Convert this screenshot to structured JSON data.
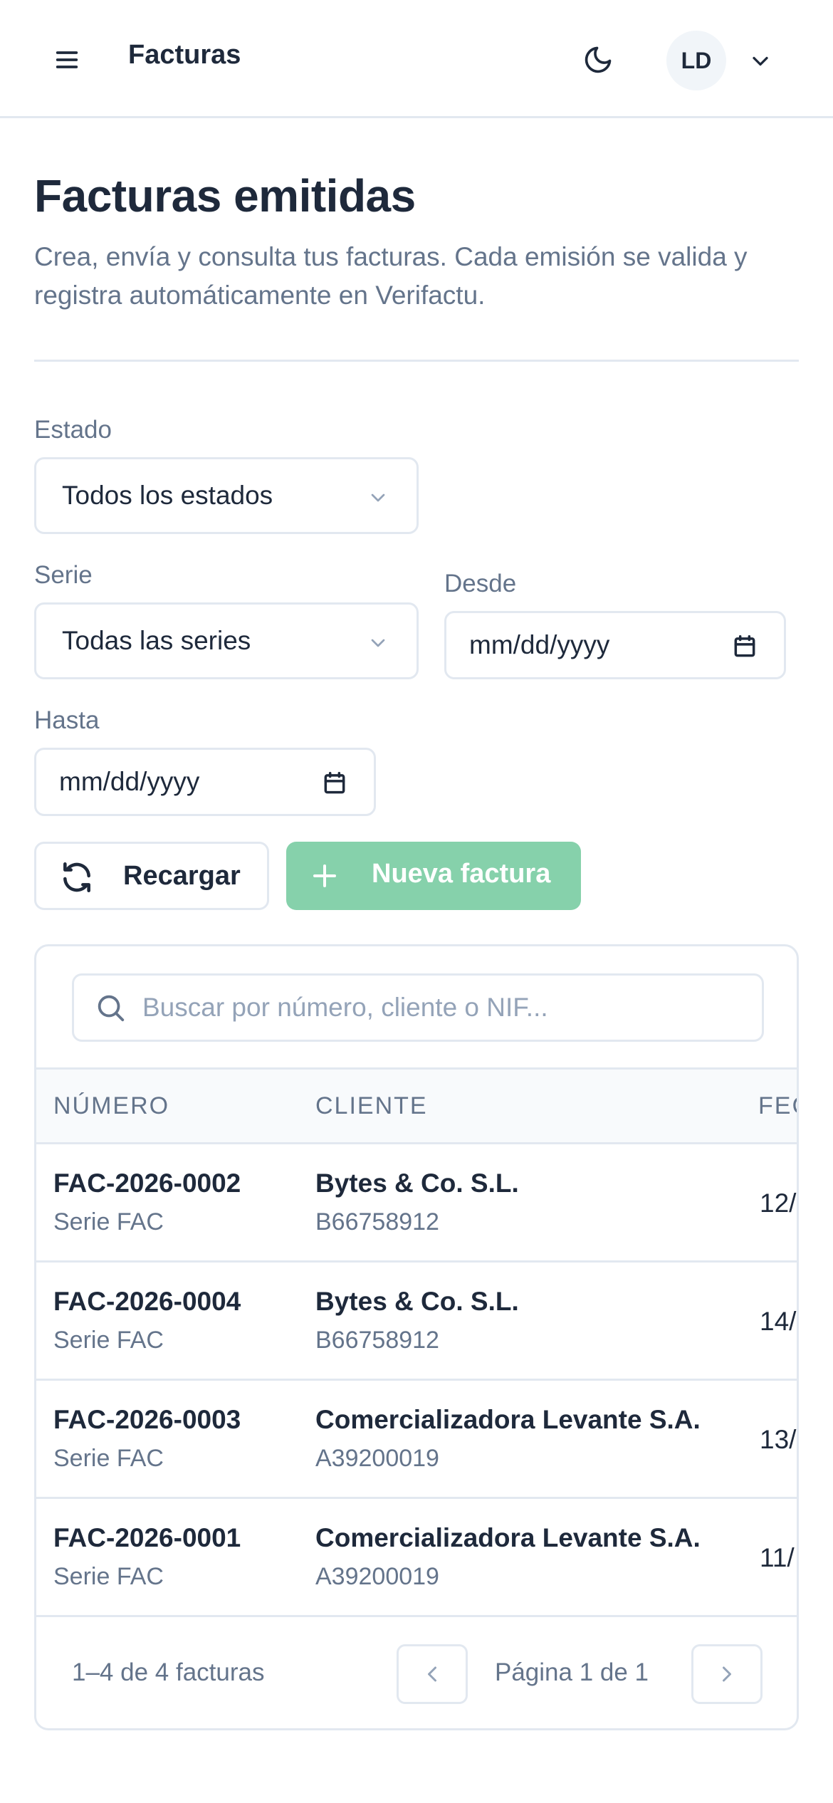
{
  "header": {
    "title": "Facturas",
    "avatar_initials": "LD",
    "icons": [
      "menu-icon",
      "moon-icon",
      "chevron-down-icon"
    ]
  },
  "page": {
    "title": "Facturas emitidas",
    "subtitle": "Crea, envía y consulta tus facturas. Cada emisión se valida y registra automáticamente en Verifactu."
  },
  "filters": {
    "estado": {
      "label": "Estado",
      "value": "Todos los estados"
    },
    "serie": {
      "label": "Serie",
      "value": "Todas las series"
    },
    "desde": {
      "label": "Desde",
      "placeholder": "mm/dd/yyyy"
    },
    "hasta": {
      "label": "Hasta",
      "placeholder": "mm/dd/yyyy"
    }
  },
  "actions": {
    "reload_label": "Recargar",
    "new_label": "Nueva factura",
    "new_color": "#86d1ab"
  },
  "table": {
    "search_placeholder": "Buscar por número, cliente o NIF...",
    "columns": [
      "NÚMERO",
      "CLIENTE",
      "FEC"
    ],
    "rows": [
      {
        "numero": "FAC-2026-0002",
        "serie": "Serie FAC",
        "cliente": "Bytes & Co. S.L.",
        "nif": "B66758912",
        "fecha": "12/"
      },
      {
        "numero": "FAC-2026-0004",
        "serie": "Serie FAC",
        "cliente": "Bytes & Co. S.L.",
        "nif": "B66758912",
        "fecha": "14/"
      },
      {
        "numero": "FAC-2026-0003",
        "serie": "Serie FAC",
        "cliente": "Comercializadora Levante S.A.",
        "nif": "A39200019",
        "fecha": "13/"
      },
      {
        "numero": "FAC-2026-0001",
        "serie": "Serie FAC",
        "cliente": "Comercializadora Levante S.A.",
        "nif": "A39200019",
        "fecha": "11/"
      }
    ],
    "count_text": "1–4 de 4 facturas",
    "page_text": "Página 1 de 1"
  }
}
